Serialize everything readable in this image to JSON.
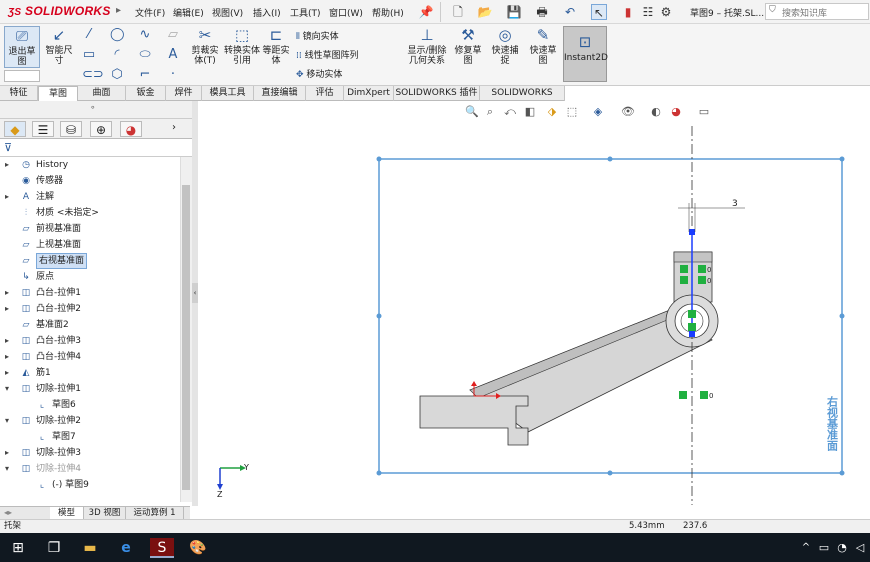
{
  "app": {
    "logo": "SOLIDWORKS",
    "title": "草图9 – 托架.SL...",
    "search_placeholder": "搜索知识库"
  },
  "menu": [
    "文件(F)",
    "编辑(E)",
    "视图(V)",
    "插入(I)",
    "工具(T)",
    "窗口(W)",
    "帮助(H)"
  ],
  "ribbon": {
    "exit_sketch": "退出草图",
    "smart_dim": "智能尺寸",
    "trim": "剪裁实体(T)",
    "convert": "转换实体引用",
    "offset": "等距实体",
    "mirror": "镜向实体",
    "linear_pattern": "线性草图阵列",
    "move": "移动实体",
    "show_relations": "显示/删除几何关系",
    "repair": "修复草图",
    "quick_snap": "快速捕捉",
    "rapid_sketch": "快速草图",
    "instant2d": "Instant2D"
  },
  "tabs": [
    "特征",
    "草图",
    "曲面",
    "钣金",
    "焊件",
    "模具工具",
    "直接编辑",
    "评估",
    "DimXpert",
    "SOLIDWORKS 插件",
    "SOLIDWORKS MBD"
  ],
  "active_tab": "草图",
  "tree": [
    {
      "label": "History",
      "icon": "history-icon",
      "arrow": "▸"
    },
    {
      "label": "传感器",
      "icon": "sensor-icon",
      "arrow": ""
    },
    {
      "label": "注解",
      "icon": "annotation-icon",
      "arrow": "▸"
    },
    {
      "label": "材质 <未指定>",
      "icon": "material-icon",
      "arrow": ""
    },
    {
      "label": "前视基准面",
      "icon": "plane-icon",
      "arrow": ""
    },
    {
      "label": "上视基准面",
      "icon": "plane-icon",
      "arrow": ""
    },
    {
      "label": "右视基准面",
      "icon": "plane-icon",
      "arrow": "",
      "selected": true
    },
    {
      "label": "原点",
      "icon": "origin-icon",
      "arrow": ""
    },
    {
      "label": "凸台-拉伸1",
      "icon": "extrude-icon",
      "arrow": "▸"
    },
    {
      "label": "凸台-拉伸2",
      "icon": "extrude-icon",
      "arrow": "▸"
    },
    {
      "label": "基准面2",
      "icon": "plane-icon",
      "arrow": ""
    },
    {
      "label": "凸台-拉伸3",
      "icon": "extrude-icon",
      "arrow": "▸"
    },
    {
      "label": "凸台-拉伸4",
      "icon": "extrude-icon",
      "arrow": "▸"
    },
    {
      "label": "筋1",
      "icon": "rib-icon",
      "arrow": "▸"
    },
    {
      "label": "切除-拉伸1",
      "icon": "cut-icon",
      "arrow": "▾"
    },
    {
      "label": "草图6",
      "icon": "sketch-icon",
      "arrow": "",
      "indent": true
    },
    {
      "label": "切除-拉伸2",
      "icon": "cut-icon",
      "arrow": "▾"
    },
    {
      "label": "草图7",
      "icon": "sketch-icon",
      "arrow": "",
      "indent": true
    },
    {
      "label": "切除-拉伸3",
      "icon": "cut-icon",
      "arrow": "▸"
    },
    {
      "label": "切除-拉伸4",
      "icon": "cut-icon",
      "arrow": "▾",
      "grey": true
    },
    {
      "label": "(-) 草图9",
      "icon": "sketch-icon",
      "arrow": "",
      "indent": true
    }
  ],
  "bottom_tabs": [
    "模型",
    "3D 视图",
    "运动算例 1"
  ],
  "status": {
    "doc": "托架",
    "x": "5.43mm",
    "y": "237.6"
  },
  "canvas": {
    "dimension": "3",
    "view_label": "右视基准面",
    "axis_y": "Y",
    "axis_z": "Z"
  }
}
